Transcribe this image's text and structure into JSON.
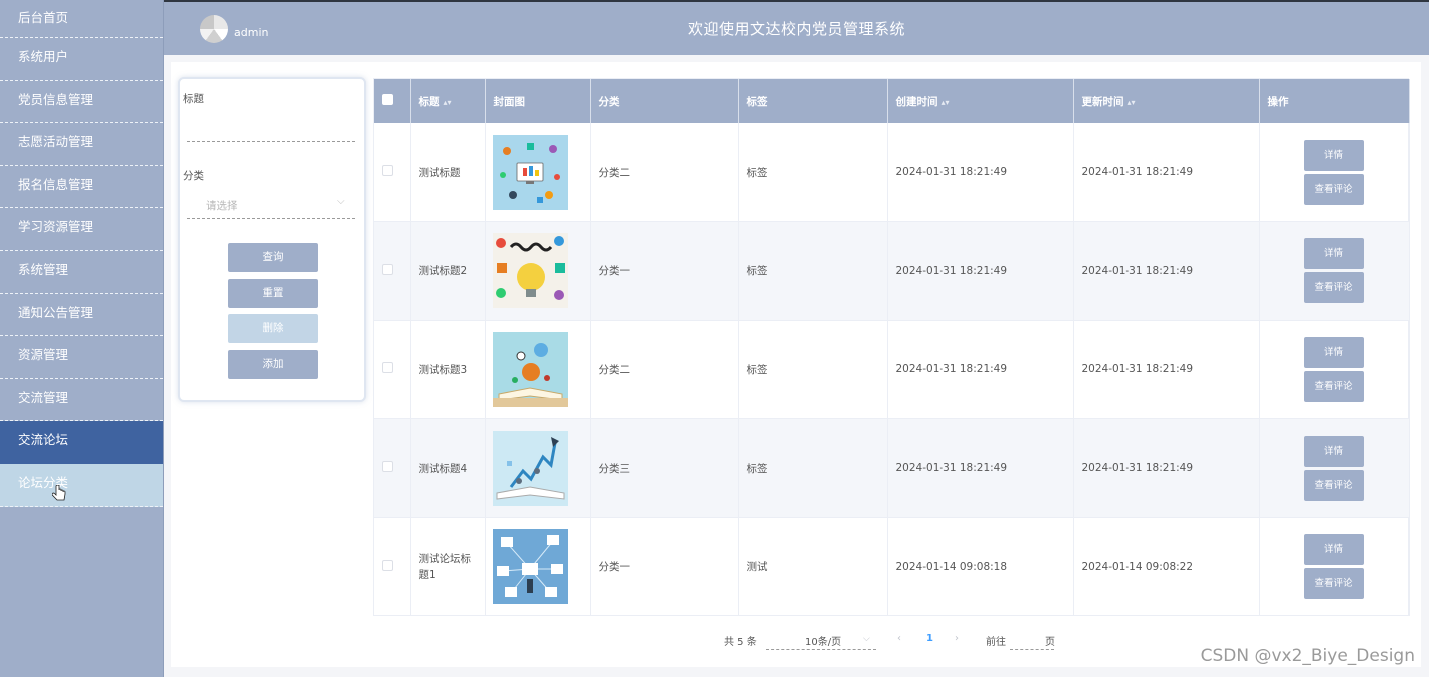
{
  "sidebar": {
    "items": [
      {
        "label": "后台首页"
      },
      {
        "label": "系统用户"
      },
      {
        "label": "党员信息管理"
      },
      {
        "label": "志愿活动管理"
      },
      {
        "label": "报名信息管理"
      },
      {
        "label": "学习资源管理"
      },
      {
        "label": "系统管理"
      },
      {
        "label": "通知公告管理"
      },
      {
        "label": "资源管理"
      },
      {
        "label": "交流管理"
      },
      {
        "label": "交流论坛"
      }
    ],
    "sub_item": {
      "label": "论坛分类"
    }
  },
  "header": {
    "user_name": "admin",
    "title": "欢迎使用文达校内党员管理系统"
  },
  "search": {
    "title_label": "标题",
    "category_label": "分类",
    "category_placeholder": "请选择",
    "query_button": "查询",
    "reset_button": "重置",
    "delete_button": "删除",
    "add_button": "添加"
  },
  "table": {
    "headers": {
      "title": "标题",
      "cover": "封面图",
      "category": "分类",
      "tag": "标签",
      "created": "创建时间",
      "updated": "更新时间",
      "actions": "操作"
    },
    "detail_button": "详情",
    "comment_button": "查看评论",
    "rows": [
      {
        "title": "测试标题",
        "category": "分类二",
        "tag": "标签",
        "created": "2024-01-31 18:21:49",
        "updated": "2024-01-31 18:21:49"
      },
      {
        "title": "测试标题2",
        "category": "分类一",
        "tag": "标签",
        "created": "2024-01-31 18:21:49",
        "updated": "2024-01-31 18:21:49"
      },
      {
        "title": "测试标题3",
        "category": "分类二",
        "tag": "标签",
        "created": "2024-01-31 18:21:49",
        "updated": "2024-01-31 18:21:49"
      },
      {
        "title": "测试标题4",
        "category": "分类三",
        "tag": "标签",
        "created": "2024-01-31 18:21:49",
        "updated": "2024-01-31 18:21:49"
      },
      {
        "title": "测试论坛标题1",
        "category": "分类一",
        "tag": "测试",
        "created": "2024-01-14 09:08:18",
        "updated": "2024-01-14 09:08:22"
      }
    ]
  },
  "pagination": {
    "total": "共 5 条",
    "page_size": "10条/页",
    "current_page": "1",
    "goto_label": "前往",
    "page_unit": "页"
  },
  "watermark": "CSDN @vx2_Biye_Design",
  "colors": {
    "primary": "#9faec9",
    "active_menu": "#3f63a0",
    "sub_menu": "#bfd6e6",
    "page_number": "#409eff"
  }
}
